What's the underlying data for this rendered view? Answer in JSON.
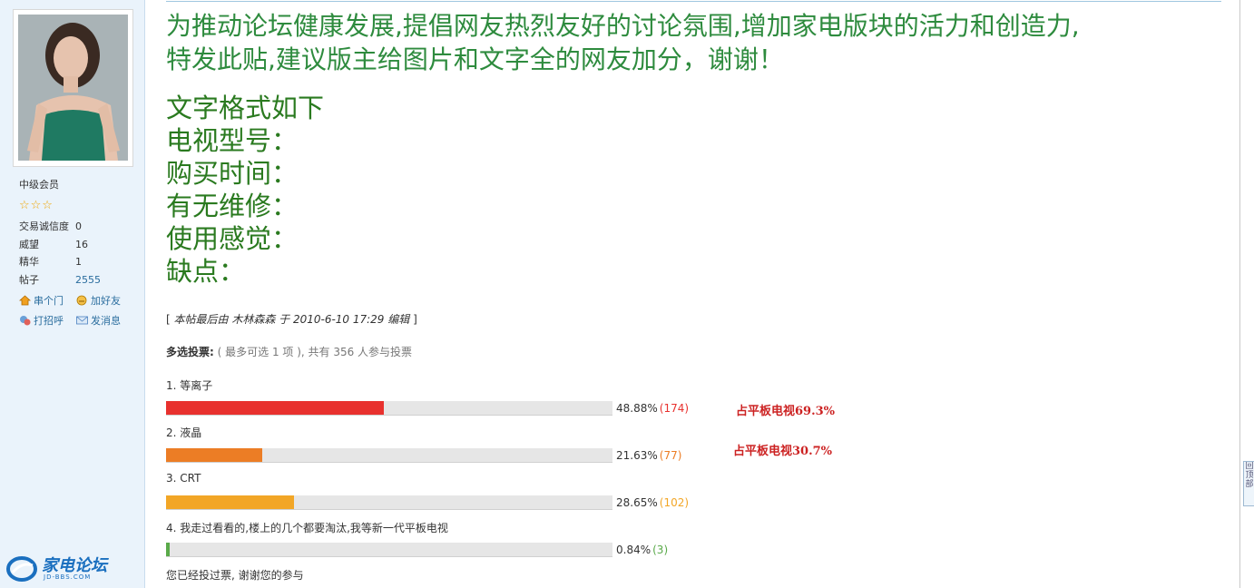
{
  "user": {
    "rank": "中级会员",
    "stars": "☆☆☆",
    "stats": [
      {
        "label": "交易诚信度",
        "value": "0"
      },
      {
        "label": "威望",
        "value": "16"
      },
      {
        "label": "精华",
        "value": "1"
      },
      {
        "label": "帖子",
        "value": "2555"
      }
    ],
    "actions": {
      "visit": "串个门",
      "add_friend": "加好友",
      "greet": "打招呼",
      "message": "发消息"
    }
  },
  "post": {
    "intro_line1": "为推动论坛健康发展,提倡网友热烈友好的讨论氛围,增加家电版块的活力和创造力,",
    "intro_line2": "特发此贴,建议版主给图片和文字全的网友加分，谢谢！",
    "format_lines": [
      "文字格式如下",
      "电视型号：",
      "购买时间：",
      "有无维修：",
      "使用感觉：",
      "缺点："
    ],
    "edit_note": "本帖最后由 木林森森 于 2010-6-10 17:29 编辑"
  },
  "poll": {
    "type_label": "多选投票:",
    "summary": "( 最多可选 1 项 ), 共有 356 人参与投票",
    "options": [
      {
        "label": "1.  等离子",
        "percent": 48.88,
        "pct_text": "48.88%",
        "count_text": "(174)",
        "color": "#e8312e"
      },
      {
        "label": "2.  液晶",
        "percent": 21.63,
        "pct_text": "21.63%",
        "count_text": "(77)",
        "color": "#ec7d25"
      },
      {
        "label": "3.  CRT",
        "percent": 28.65,
        "pct_text": "28.65%",
        "count_text": "(102)",
        "color": "#f2a626"
      },
      {
        "label": "4.  我走过看看的,楼上的几个都要淘汰,我等新一代平板电视",
        "percent": 0.84,
        "pct_text": "0.84%",
        "count_text": "(3)",
        "color": "#5aaa4a"
      }
    ],
    "annotations": [
      "占平板电视69.3%",
      "占平板电视30.7%"
    ],
    "voted_msg": "您已经投过票, 谢谢您的参与"
  },
  "logo": {
    "text": "家电论坛",
    "sub": "JD-BBS.COM"
  },
  "back_to_top": "回顶部"
}
